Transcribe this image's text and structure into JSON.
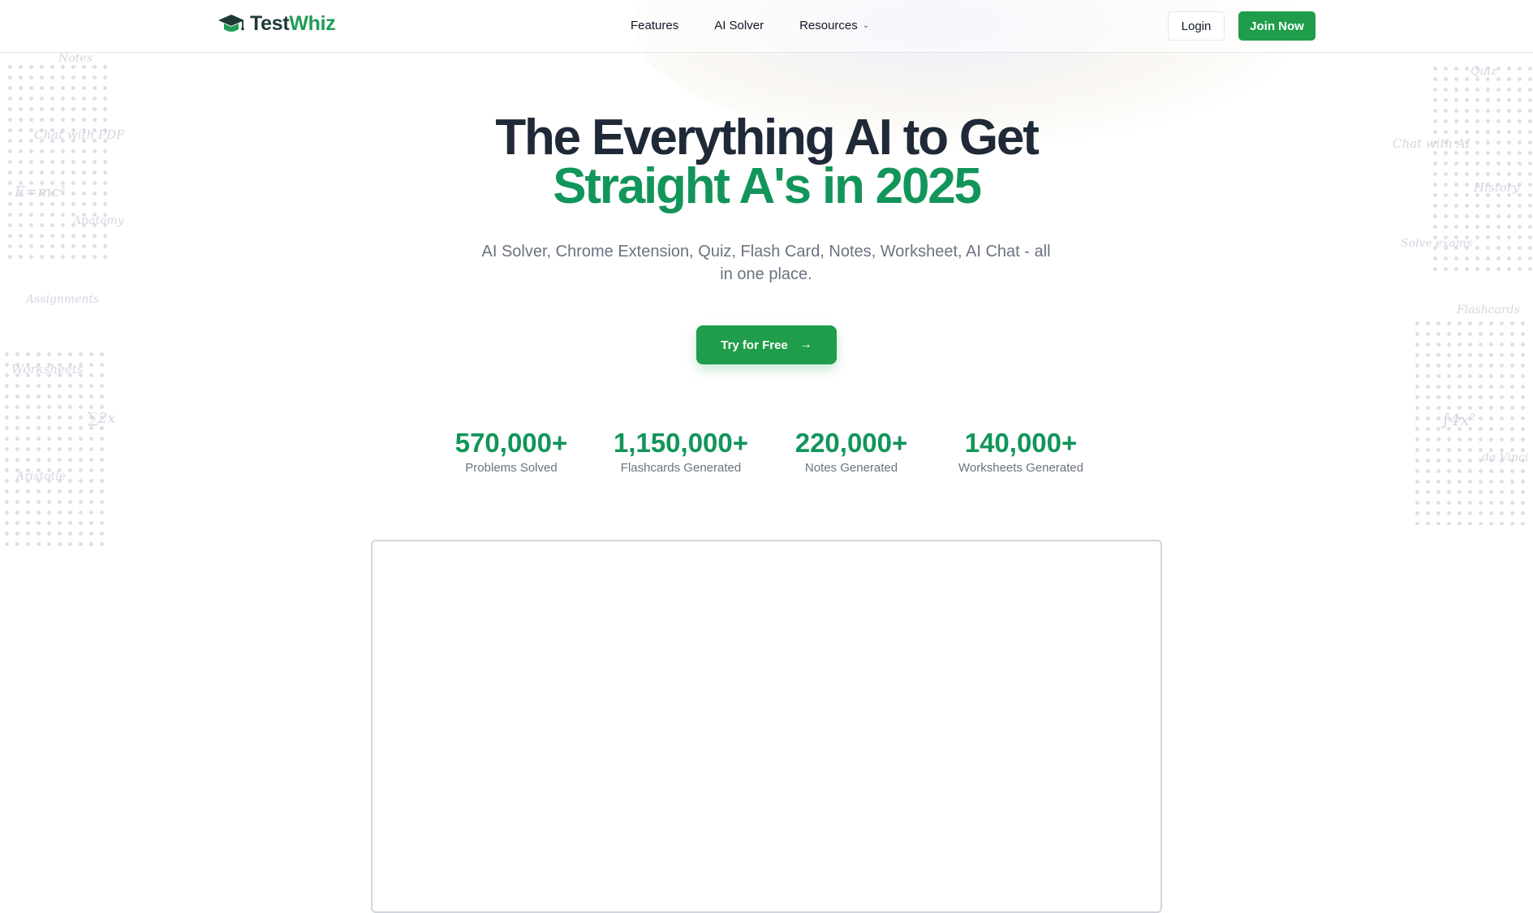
{
  "brand": {
    "name_part1": "Test",
    "name_part2": "Whiz",
    "logo_icon": "graduation-cap-icon"
  },
  "nav": {
    "links": [
      {
        "label": "Features"
      },
      {
        "label": "AI Solver"
      },
      {
        "label": "Resources",
        "icon": "chevron-down-icon"
      }
    ],
    "login_label": "Login",
    "join_label": "Join Now"
  },
  "hero": {
    "title_line1": "The Everything AI to Get",
    "title_line2": "Straight A's in 2025",
    "subtitle": "AI Solver, Chrome Extension, Quiz, Flash Card, Notes, Worksheet, AI Chat - all in one place.",
    "cta_label": "Try for Free",
    "cta_icon": "arrow-right-icon"
  },
  "stats": [
    {
      "value": "570,000+",
      "label": "Problems Solved"
    },
    {
      "value": "1,150,000+",
      "label": "Flashcards Generated"
    },
    {
      "value": "220,000+",
      "label": "Notes Generated"
    },
    {
      "value": "140,000+",
      "label": "Worksheets Generated"
    }
  ],
  "doodles": {
    "left": [
      "Notes",
      "Chat with PDF",
      "E=mc²",
      "Anatomy",
      "Assignments",
      "Worksheets",
      "∑2x",
      "Aristotle"
    ],
    "right": [
      "Quiz",
      "Chat with AI",
      "History",
      "Solve exams",
      "Flashcards",
      "∫4x²",
      "da Vinci"
    ]
  },
  "colors": {
    "accent": "#1f9d4a",
    "accent_text": "#12955a",
    "heading": "#1f2937",
    "muted": "#6b7280"
  }
}
